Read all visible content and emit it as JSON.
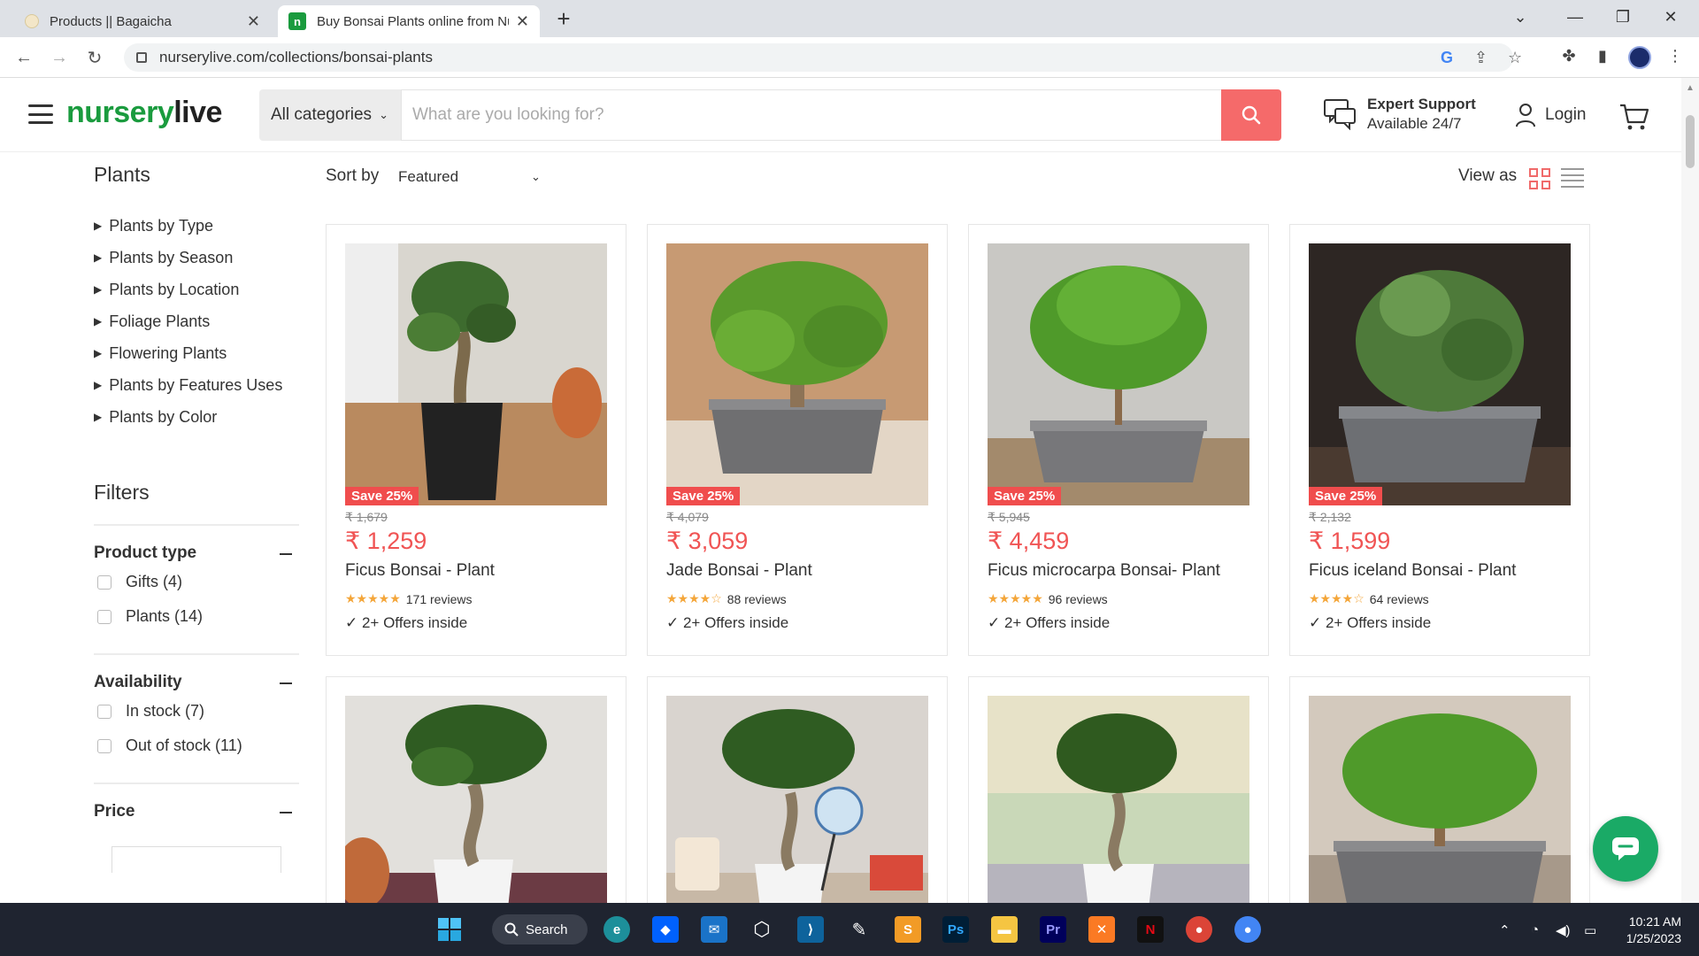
{
  "browser": {
    "tabs": [
      {
        "title": "Products || Bagaicha"
      },
      {
        "title": "Buy Bonsai Plants online from Nu"
      }
    ],
    "url": "nurserylive.com/collections/bonsai-plants"
  },
  "header": {
    "logo_green": "nursery",
    "logo_dark": "live",
    "category_select": "All categories",
    "search_placeholder": "What are you looking for?",
    "support_title": "Expert Support",
    "support_sub": "Available 24/7",
    "login": "Login"
  },
  "sidebar": {
    "plants_heading": "Plants",
    "items": [
      {
        "label": "Plants by Type"
      },
      {
        "label": "Plants by Season"
      },
      {
        "label": "Plants by Location"
      },
      {
        "label": "Foliage Plants"
      },
      {
        "label": "Flowering Plants"
      },
      {
        "label": "Plants by Features Uses"
      },
      {
        "label": "Plants by Color"
      }
    ],
    "filters_heading": "Filters",
    "groups": [
      {
        "title": "Product type",
        "options": [
          {
            "label": "Gifts (4)"
          },
          {
            "label": "Plants (14)"
          }
        ]
      },
      {
        "title": "Availability",
        "options": [
          {
            "label": "In stock (7)"
          },
          {
            "label": "Out of stock (11)"
          }
        ]
      },
      {
        "title": "Price"
      }
    ]
  },
  "toolbar": {
    "sort_label": "Sort by",
    "sort_value": "Featured",
    "view_label": "View as"
  },
  "products": [
    {
      "badge": "Save 25%",
      "old_price": "₹ 1,679",
      "price": "₹ 1,259",
      "name": "Ficus Bonsai - Plant",
      "stars": "★★★★★",
      "reviews": "171 reviews",
      "offers": "✓ 2+ Offers inside"
    },
    {
      "badge": "Save 25%",
      "old_price": "₹ 4,079",
      "price": "₹ 3,059",
      "name": "Jade Bonsai - Plant",
      "stars": "★★★★☆",
      "reviews": "88 reviews",
      "offers": "✓ 2+ Offers inside"
    },
    {
      "badge": "Save 25%",
      "old_price": "₹ 5,945",
      "price": "₹ 4,459",
      "name": "Ficus microcarpa Bonsai- Plant",
      "stars": "★★★★★",
      "reviews": "96 reviews",
      "offers": "✓ 2+ Offers inside"
    },
    {
      "badge": "Save 25%",
      "old_price": "₹ 2,132",
      "price": "₹ 1,599",
      "name": "Ficus iceland Bonsai - Plant",
      "stars": "★★★★☆",
      "reviews": "64 reviews",
      "offers": "✓ 2+ Offers inside"
    }
  ],
  "taskbar": {
    "search_label": "Search",
    "time": "10:21 AM",
    "date": "1/25/2023"
  },
  "colors": {
    "brand_green": "#1a9b3e",
    "accent_red": "#f05454",
    "search_button": "#f56a6a",
    "chat_green": "#1aaa66"
  }
}
